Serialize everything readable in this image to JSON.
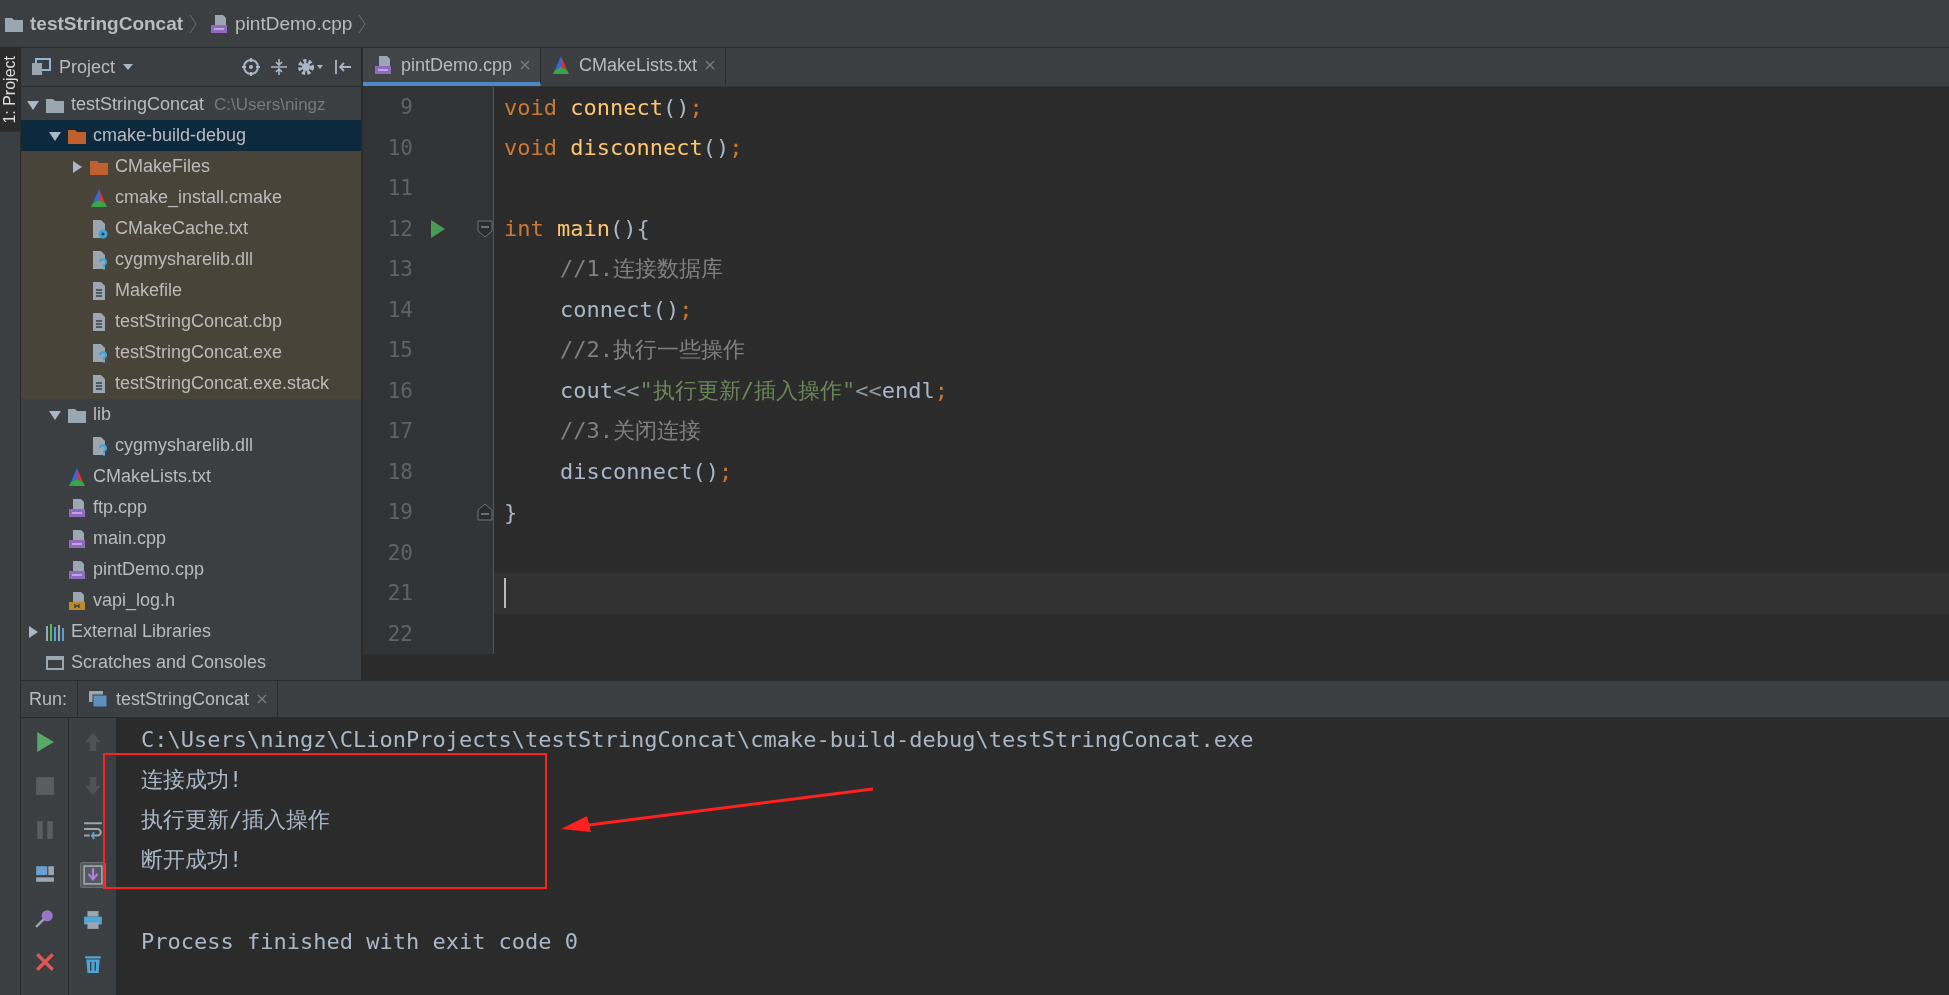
{
  "breadcrumbs": [
    {
      "label": "testStringConcat",
      "kind": "folder"
    },
    {
      "label": "pintDemo.cpp",
      "kind": "cpp"
    }
  ],
  "side_tab": {
    "label": "1: Project",
    "selected": true
  },
  "project_panel": {
    "title": "Project",
    "tree": [
      {
        "label": "testStringConcat",
        "hint": "C:\\Users\\ningz",
        "kind": "folder",
        "expanded": true,
        "selected": false,
        "children": [
          {
            "label": "cmake-build-debug",
            "kind": "folder",
            "excluded": true,
            "expanded": true,
            "selected": true,
            "children": [
              {
                "label": "CMakeFiles",
                "kind": "folder",
                "excluded": true,
                "expanded": false,
                "selected": false
              },
              {
                "label": "cmake_install.cmake",
                "kind": "cmake",
                "selected": false
              },
              {
                "label": "CMakeCache.txt",
                "kind": "cache",
                "selected": false
              },
              {
                "label": "cygmysharelib.dll",
                "kind": "unknown",
                "selected": false
              },
              {
                "label": "Makefile",
                "kind": "text",
                "selected": false
              },
              {
                "label": "testStringConcat.cbp",
                "kind": "text",
                "selected": false
              },
              {
                "label": "testStringConcat.exe",
                "kind": "unknown",
                "selected": false
              },
              {
                "label": "testStringConcat.exe.stack",
                "kind": "text",
                "selected": false
              }
            ]
          },
          {
            "label": "lib",
            "kind": "folder",
            "excluded": false,
            "expanded": true,
            "selected": false,
            "children": [
              {
                "label": "cygmysharelib.dll",
                "kind": "unknown",
                "selected": false
              }
            ]
          },
          {
            "label": "CMakeLists.txt",
            "kind": "cmake",
            "selected": false
          },
          {
            "label": "ftp.cpp",
            "kind": "cpp",
            "selected": false
          },
          {
            "label": "main.cpp",
            "kind": "cpp",
            "selected": false
          },
          {
            "label": "pintDemo.cpp",
            "kind": "cpp",
            "selected": false
          },
          {
            "label": "vapi_log.h",
            "kind": "header",
            "selected": false
          }
        ]
      },
      {
        "label": "External Libraries",
        "kind": "libraries",
        "expanded": false,
        "selected": false
      },
      {
        "label": "Scratches and Consoles",
        "kind": "scratches",
        "selected": false
      }
    ]
  },
  "editor": {
    "tabs": [
      {
        "label": "pintDemo.cpp",
        "kind": "cpp",
        "selected": true
      },
      {
        "label": "CMakeLists.txt",
        "kind": "cmake",
        "selected": false
      }
    ],
    "lines": [
      {
        "number": "9",
        "current": false,
        "tokens": [
          {
            "kind": "kw",
            "text": "void "
          },
          {
            "kind": "decl",
            "text": "connect"
          },
          {
            "kind": "plain",
            "text": "()"
          },
          {
            "kind": "semi",
            "text": ";"
          }
        ]
      },
      {
        "number": "10",
        "current": false,
        "tokens": [
          {
            "kind": "kw",
            "text": "void "
          },
          {
            "kind": "decl",
            "text": "disconnect"
          },
          {
            "kind": "plain",
            "text": "()"
          },
          {
            "kind": "semi",
            "text": ";"
          }
        ]
      },
      {
        "number": "11",
        "current": false
      },
      {
        "number": "12",
        "current": false,
        "run_marker": true,
        "fold_start": true,
        "tokens": [
          {
            "kind": "kw",
            "text": "int "
          },
          {
            "kind": "decl",
            "text": "main"
          },
          {
            "kind": "plain",
            "text": "(){"
          }
        ]
      },
      {
        "number": "13",
        "current": false,
        "indented": true,
        "tokens": [
          {
            "kind": "comment",
            "text": "//1.连接数据库"
          }
        ]
      },
      {
        "number": "14",
        "current": false,
        "indented": true,
        "tokens": [
          {
            "kind": "plain",
            "text": "connect()"
          },
          {
            "kind": "semi",
            "text": ";"
          }
        ]
      },
      {
        "number": "15",
        "current": false,
        "indented": true,
        "tokens": [
          {
            "kind": "comment",
            "text": "//2.执行一些操作"
          }
        ]
      },
      {
        "number": "16",
        "current": false,
        "indented": true,
        "tokens": [
          {
            "kind": "plain",
            "text": "cout"
          },
          {
            "kind": "op",
            "text": "<<"
          },
          {
            "kind": "string",
            "text": "\"执行更新/插入操作\""
          },
          {
            "kind": "op",
            "text": "<<"
          },
          {
            "kind": "plain",
            "text": "endl"
          },
          {
            "kind": "semi",
            "text": ";"
          }
        ]
      },
      {
        "number": "17",
        "current": false,
        "indented": true,
        "tokens": [
          {
            "kind": "comment",
            "text": "//3.关闭连接"
          }
        ]
      },
      {
        "number": "18",
        "current": false,
        "indented": true,
        "tokens": [
          {
            "kind": "plain",
            "text": "disconnect()"
          },
          {
            "kind": "semi",
            "text": ";"
          }
        ]
      },
      {
        "number": "19",
        "current": false,
        "fold_end": true,
        "tokens": [
          {
            "kind": "plain",
            "text": "}"
          }
        ]
      },
      {
        "number": "20",
        "current": false
      },
      {
        "number": "21",
        "current": true
      },
      {
        "number": "22",
        "current": false
      }
    ]
  },
  "run_panel": {
    "label": "Run:",
    "tabs": [
      {
        "label": "testStringConcat",
        "selected": true
      }
    ],
    "scroll_to_end": {
      "on": true
    },
    "output": [
      {
        "text": "C:\\Users\\ningz\\CLionProjects\\testStringConcat\\cmake-build-debug\\testStringConcat.exe"
      },
      {
        "text": "连接成功!"
      },
      {
        "text": "执行更新/插入操作"
      },
      {
        "text": "断开成功!"
      },
      {
        "text": "Process finished with exit code 0",
        "gap_before": true
      }
    ]
  }
}
